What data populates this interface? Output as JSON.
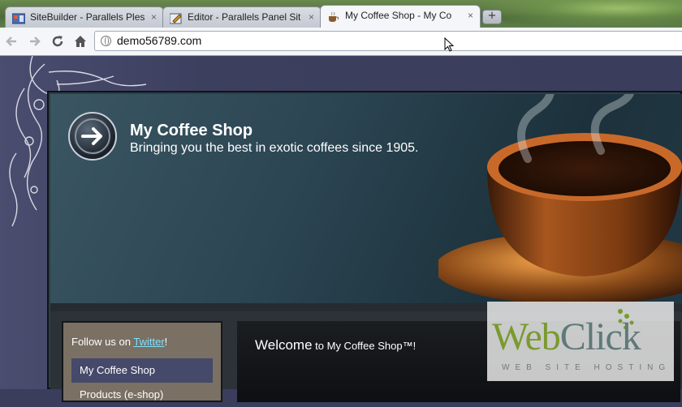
{
  "browser": {
    "tabs": [
      {
        "title": "SiteBuilder - Parallels Ples",
        "favicon": "sitebuilder-icon",
        "close": "×"
      },
      {
        "title": "Editor - Parallels Panel Sit",
        "favicon": "editor-icon",
        "close": "×"
      },
      {
        "title": "My Coffee Shop - My Co",
        "favicon": "coffee-cup-icon",
        "close": "×",
        "active": true
      }
    ],
    "new_tab": "+",
    "back_icon": "back-arrow-icon",
    "forward_icon": "forward-arrow-icon",
    "reload_icon": "reload-icon",
    "home_icon": "home-icon",
    "url": "demo56789.com"
  },
  "site": {
    "title": "My Coffee Shop",
    "tagline": "Bringing you the best in exotic coffees since 1905.",
    "follow_prefix": "Follow us on ",
    "follow_link": "Twitter",
    "follow_suffix": "!",
    "nav": [
      {
        "label": "My Coffee Shop",
        "active": true
      },
      {
        "label": "Products (e-shop)"
      }
    ],
    "welcome_prefix": "Welcome",
    "welcome_suffix": " to My Coffee Shop™!"
  },
  "watermark": {
    "brand_web": "Web",
    "brand_click": "Click",
    "subtitle": "WEB SITE HOSTING"
  },
  "colors": {
    "page_bg": "#3a3d5c",
    "nav_active": "#45496a",
    "link": "#7fe0ff"
  }
}
